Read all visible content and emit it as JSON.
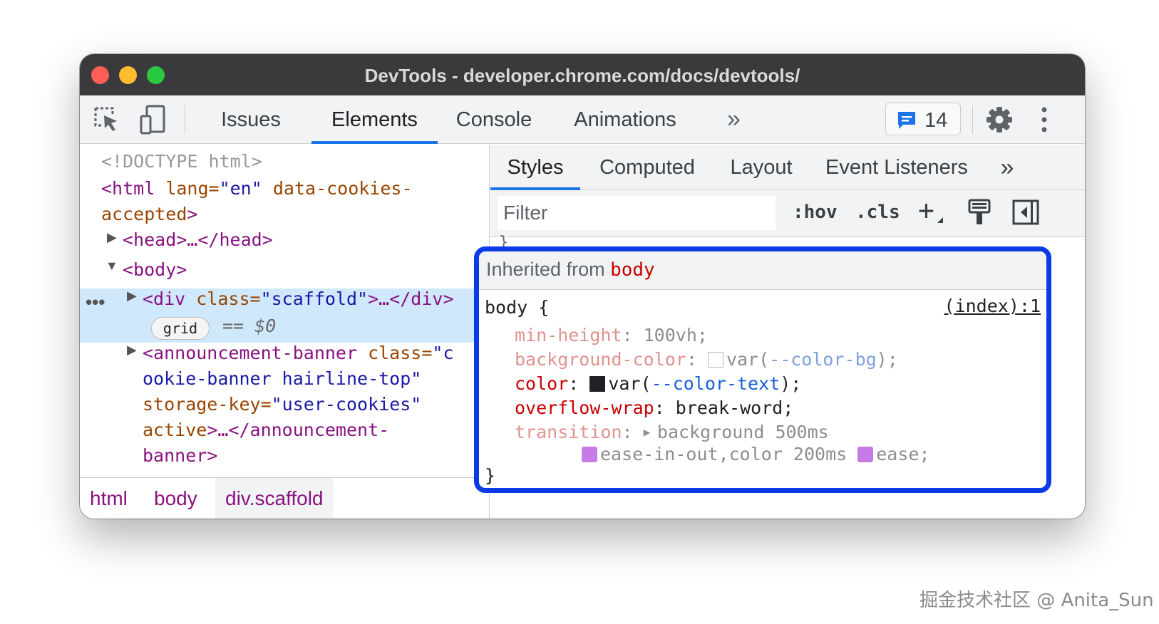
{
  "window": {
    "title": "DevTools - developer.chrome.com/docs/devtools/"
  },
  "toolbar": {
    "tabs": [
      "Issues",
      "Elements",
      "Console",
      "Animations"
    ],
    "active_tab": "Elements",
    "more_tabs": "»",
    "issues_count": "14",
    "icons": [
      "inspect-element-icon",
      "device-toolbar-icon",
      "issues-chat-icon",
      "gear-icon",
      "kebab-menu-icon"
    ]
  },
  "elements": {
    "doctype": "<!DOCTYPE html>",
    "html_open": "<html",
    "html_lang_attr": " lang=",
    "html_lang_val": "\"en\"",
    "html_cookie_attr": " data-cookies-",
    "html_cookie_attr2": "accepted",
    "html_close": ">",
    "head": "<head>…</head>",
    "body": "<body>",
    "div_open": "<div",
    "div_class_attr": " class=",
    "div_class_val": "\"scaffold\"",
    "div_rest": ">…</div>",
    "grid_badge": "grid",
    "dollar_zero": "== $0",
    "ellipsis": "•••",
    "banner_open": "<announcement-banner",
    "banner_class_attr": " class=",
    "banner_class_val1": "\"c",
    "banner_class_val2": "ookie-banner hairline-top\"",
    "banner_storage_attr": "storage-key=",
    "banner_storage_val": "\"user-cookies\"",
    "banner_active_attr": "active",
    "banner_close1": ">…</announcement-",
    "banner_close2": "banner>"
  },
  "breadcrumb": [
    "html",
    "body",
    "div.scaffold"
  ],
  "styles_panel": {
    "tabs": [
      "Styles",
      "Computed",
      "Layout",
      "Event Listeners"
    ],
    "active_tab": "Styles",
    "more_tabs": "»",
    "filter_placeholder": "Filter",
    "hov": ":hov",
    "cls": ".cls",
    "add": "+",
    "stub": "}",
    "inherited_label": "Inherited from ",
    "inherited_selector": "body",
    "rule_selector": "body {",
    "rule_close": "}",
    "source_link": "(index):1",
    "declarations": [
      {
        "prop": "min-height",
        "value": "100vh;"
      },
      {
        "prop": "background-color",
        "value_prefix": "var(",
        "var": "--color-bg",
        "value_suffix": ");"
      },
      {
        "prop": "color",
        "value_prefix": "var(",
        "var": "--color-text",
        "value_suffix": ");"
      },
      {
        "prop": "overflow-wrap",
        "value": "break-word;"
      },
      {
        "prop": "transition",
        "value": "background 500ms",
        "value_cont_1": "ease-in-out,color 200ms",
        "value_cont_2": "ease;"
      }
    ]
  },
  "colors": {
    "accent": "#1a73e8",
    "highlight_border": "#0b3be6",
    "tag": "#881280",
    "attr": "#994500",
    "value": "#1a1aa6",
    "property": "#c80000"
  },
  "watermark": "掘金技术社区 @ Anita_Sun"
}
